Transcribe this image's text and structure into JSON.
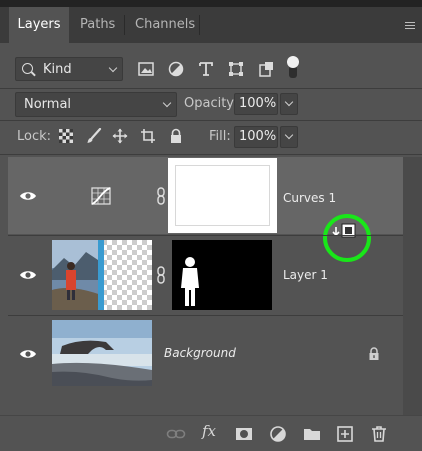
{
  "tabs": [
    {
      "label": "Layers",
      "active": true
    },
    {
      "label": "Paths",
      "active": false
    },
    {
      "label": "Channels",
      "active": false
    }
  ],
  "filter": {
    "kind_label": "Kind",
    "icons": [
      "pixel-layer-filter-icon",
      "adjustment-layer-filter-icon",
      "type-layer-filter-icon",
      "shape-layer-filter-icon",
      "smart-object-filter-icon"
    ]
  },
  "blend": {
    "mode": "Normal",
    "opacity_label": "Opacity:",
    "opacity_value": "100%",
    "lock_label": "Lock:",
    "fill_label": "Fill:",
    "fill_value": "100%"
  },
  "layers": [
    {
      "name": "Curves 1",
      "type": "adjustment",
      "selected": true,
      "italic": false,
      "locked": false
    },
    {
      "name": "Layer 1",
      "type": "pixel-with-mask",
      "selected": false,
      "italic": false,
      "locked": false
    },
    {
      "name": "Background",
      "type": "background",
      "selected": false,
      "italic": true,
      "locked": true
    }
  ],
  "colors": {
    "panel_bg": "#535353",
    "selected_layer_bg": "#666666",
    "highlight_circle": "#19e619"
  },
  "bottom_icons": [
    "link-layers-icon",
    "layer-style-fx-icon",
    "add-mask-icon",
    "new-adjustment-layer-icon",
    "new-group-icon",
    "new-layer-icon",
    "delete-layer-icon"
  ],
  "bottom_fx_label": "fx"
}
